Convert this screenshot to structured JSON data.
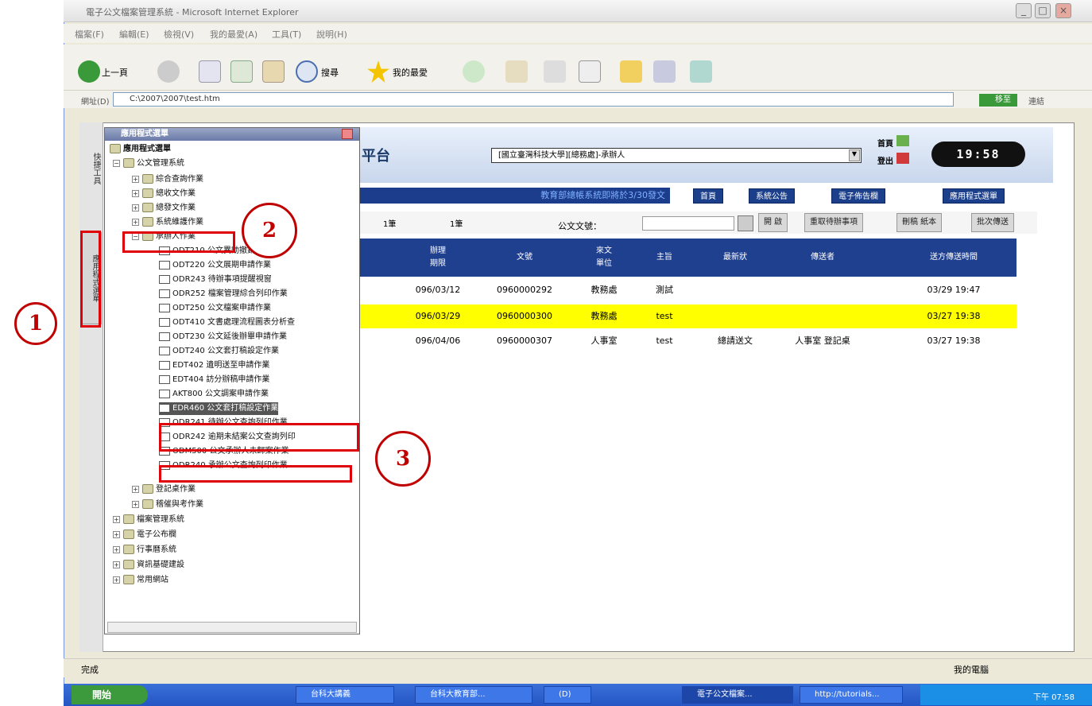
{
  "window": {
    "title": "電子公文檔案管理系統 - Microsoft Internet Explorer"
  },
  "menu": [
    "檔案(F)",
    "編輯(E)",
    "檢視(V)",
    "我的最愛(A)",
    "工具(T)",
    "說明(H)"
  ],
  "toolbar": {
    "back": "上一頁",
    "search": "搜尋",
    "favorites": "我的最愛"
  },
  "address": {
    "label": "網址(D)",
    "value": "C:\\2007\\2007\\test.htm",
    "go": "移至",
    "links": "連結"
  },
  "sidebar_tabs": [
    "快捷工具",
    "應用程式選單"
  ],
  "tree": {
    "header": "應用程式選單",
    "root": "應用程式選單",
    "system": "公文管理系統",
    "nodes": [
      {
        "label": "綜合查詢作業",
        "level": 2,
        "pm": "+"
      },
      {
        "label": "總收文作業",
        "level": 2,
        "pm": "+"
      },
      {
        "label": "總發文作業",
        "level": 2,
        "pm": "+"
      },
      {
        "label": "系統維護作業",
        "level": 2,
        "pm": "+"
      },
      {
        "label": "承辦人作業",
        "level": 2,
        "pm": "-"
      },
      {
        "label": "ODT210 公文異動撤銷作業",
        "level": 3
      },
      {
        "label": "ODT220 公文展期申請作業",
        "level": 3
      },
      {
        "label": "ODR243 待辦事項提醒視窗",
        "level": 3
      },
      {
        "label": "ODR252 檔案管理綜合列印作業",
        "level": 3
      },
      {
        "label": "ODT250 公文檔案申請作業",
        "level": 3
      },
      {
        "label": "ODT410 文書處理流程圖表分析查",
        "level": 3
      },
      {
        "label": "ODT230 公文延後辦畢申請作業",
        "level": 3
      },
      {
        "label": "ODT240 公文套打稿設定作業",
        "level": 3
      },
      {
        "label": "EDT402 遺明送至申請作業",
        "level": 3
      },
      {
        "label": "EDT404 訪分辦稿申請作業",
        "level": 3
      },
      {
        "label": "AKT800 公文調案申請作業",
        "level": 3
      },
      {
        "label": "EDR460 公文套打稿設定作業",
        "level": 3,
        "sel": true
      },
      {
        "label": "ODR241 待辦公文查詢列印作業",
        "level": 3
      },
      {
        "label": "ODR242 逾期未結案公文查詢列印",
        "level": 3
      },
      {
        "label": "ODM500 公文承辦人未歸案作業",
        "level": 3
      },
      {
        "label": "ODR240 承辦公文查詢列印作業",
        "level": 3
      },
      {
        "label": "登記桌作業",
        "level": 2,
        "pm": "+"
      },
      {
        "label": "稽催與考作業",
        "level": 2,
        "pm": "+"
      },
      {
        "label": "檔案管理系統",
        "level": 1,
        "pm": "+"
      },
      {
        "label": "電子公布欄",
        "level": 1,
        "pm": "+"
      },
      {
        "label": "行事曆系統",
        "level": 1,
        "pm": "+"
      },
      {
        "label": "資訊基礎建設",
        "level": 1,
        "pm": "+"
      },
      {
        "label": "常用網站",
        "level": 1,
        "pm": "+"
      }
    ]
  },
  "banner": {
    "title_fragment": "平台",
    "role": "[國立臺灣科技大學][總務處]-承辦人",
    "home": "首頁",
    "logout": "登出",
    "clock": "19:58",
    "marquee": "教育部總帳系統即將於3/30發文",
    "nav": [
      "首頁",
      "系統公告",
      "電子佈告欄",
      "應用程式選單"
    ]
  },
  "actions": {
    "count1": "1筆",
    "count2": "1筆",
    "docno_label": "公文文號：",
    "buttons": [
      "開  啟",
      "重取待辦事項",
      "刪稿 紙本",
      "批次傳送"
    ]
  },
  "table": {
    "headers": [
      "辦理\n期限",
      "文號",
      "來文\n單位",
      "主旨",
      "最新狀",
      "傳送者",
      "送方傳送時間"
    ],
    "rows": [
      [
        "096/03/12",
        "0960000292",
        "教務處",
        "測試",
        "",
        "",
        "03/29 19:47"
      ],
      [
        "096/03/29",
        "0960000300",
        "教務處",
        "test",
        "",
        "",
        "03/27 19:38"
      ],
      [
        "096/04/06",
        "0960000307",
        "人事室",
        "test",
        "總請送文",
        "人事室 登記桌",
        "03/27 19:38"
      ]
    ]
  },
  "status": {
    "left": "完成",
    "zone": "我的電腦"
  },
  "taskbar": {
    "start": "開始",
    "tasks": [
      "台科大講義",
      "台科大教育部...",
      "(D)",
      "電子公文檔案...",
      "http://tutorials..."
    ],
    "clock": "下午 07:58"
  },
  "callouts": [
    "1",
    "2",
    "3"
  ]
}
